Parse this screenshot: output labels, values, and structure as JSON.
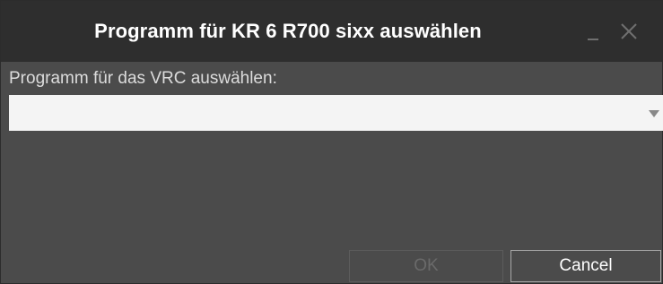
{
  "window": {
    "title": "Programm für KR 6 R700 sixx auswählen",
    "minimize_glyph": "minimize-icon",
    "close_glyph": "close-icon"
  },
  "form": {
    "prompt_label": "Programm für das VRC auswählen:",
    "program_select": {
      "value": "",
      "icon": "chevron-down-icon"
    }
  },
  "buttons": {
    "ok_label": "OK",
    "ok_enabled": false,
    "cancel_label": "Cancel"
  },
  "colors": {
    "titlebar": "#2e2e2e",
    "body": "#4b4b4b",
    "select_bg": "#f4f4f4",
    "text": "#ffffff"
  }
}
